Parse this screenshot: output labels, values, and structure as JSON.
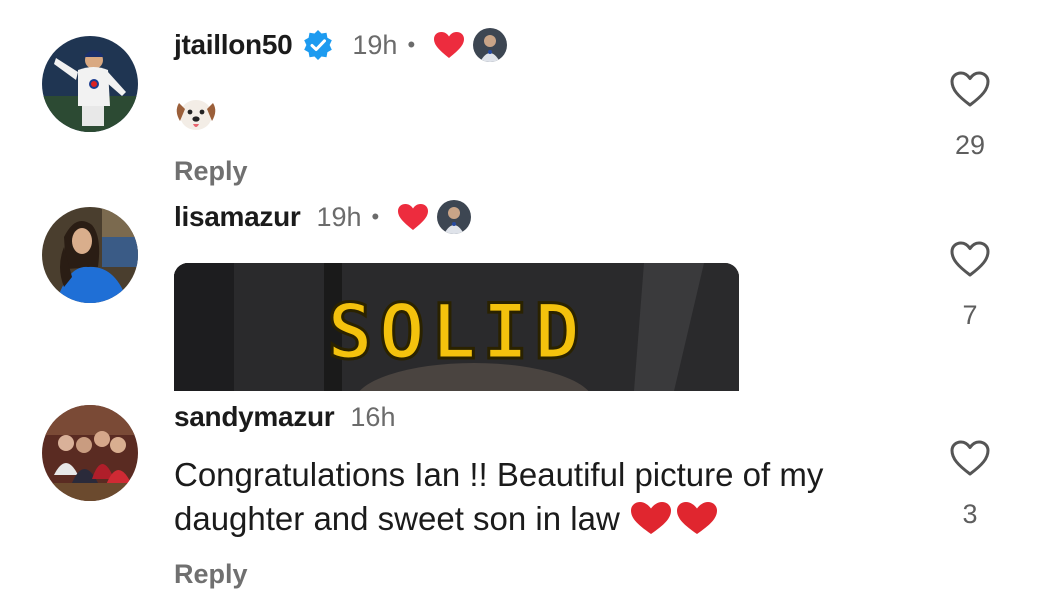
{
  "colors": {
    "verified_badge": "#1d9bf0",
    "creator_heart": "#ed2c3e",
    "username": "#1b1b1b",
    "meta_text": "#6b6b6b",
    "gif_text": "#f4c20d"
  },
  "comments": [
    {
      "username": "jtaillon50",
      "verified": true,
      "time": "19h",
      "separator": "•",
      "liked_by_creator": true,
      "body_emoji": "dog-face-emoji",
      "reply_label": "Reply",
      "like_count": "29",
      "like_icon": "heart-outline-icon"
    },
    {
      "username": "lisamazur",
      "verified": false,
      "time": "19h",
      "separator": "•",
      "liked_by_creator": true,
      "gif_text": "SOLID",
      "like_count": "7",
      "like_icon": "heart-outline-icon"
    },
    {
      "username": "sandymazur",
      "verified": false,
      "time": "16h",
      "body_text": "Congratulations Ian !! Beautiful picture of my daughter and sweet son in law",
      "body_trailing_emoji": "two-red-hearts",
      "reply_label": "Reply",
      "like_count": "3",
      "like_icon": "heart-outline-icon"
    }
  ]
}
